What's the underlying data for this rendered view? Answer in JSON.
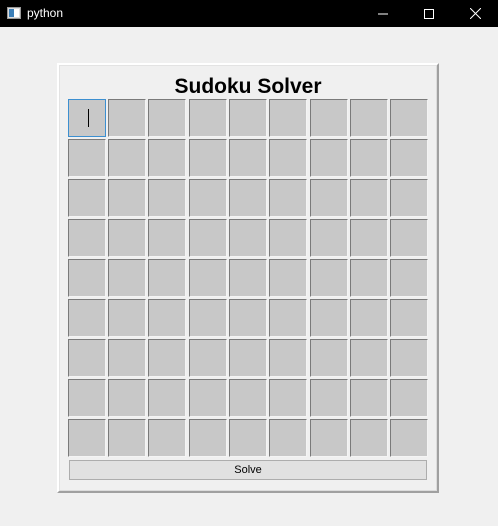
{
  "window": {
    "title": "python",
    "controls": {
      "minimize_icon": "minimize-icon",
      "maximize_icon": "maximize-icon",
      "close_icon": "close-icon"
    }
  },
  "app": {
    "heading": "Sudoku Solver",
    "solve_label": "Solve",
    "focused_cell": "r1c1",
    "board": [
      [
        "",
        "",
        "",
        "",
        "",
        "",
        "",
        "",
        ""
      ],
      [
        "",
        "",
        "",
        "",
        "",
        "",
        "",
        "",
        ""
      ],
      [
        "",
        "",
        "",
        "",
        "",
        "",
        "",
        "",
        ""
      ],
      [
        "",
        "",
        "",
        "",
        "",
        "",
        "",
        "",
        ""
      ],
      [
        "",
        "",
        "",
        "",
        "",
        "",
        "",
        "",
        ""
      ],
      [
        "",
        "",
        "",
        "",
        "",
        "",
        "",
        "",
        ""
      ],
      [
        "",
        "",
        "",
        "",
        "",
        "",
        "",
        "",
        ""
      ],
      [
        "",
        "",
        "",
        "",
        "",
        "",
        "",
        "",
        ""
      ],
      [
        "",
        "",
        "",
        "",
        "",
        "",
        "",
        "",
        ""
      ]
    ]
  },
  "colors": {
    "titlebar": "#000000",
    "background": "#f0f0f0",
    "cell": "#c8c8c8",
    "focus_border": "#3c8fd0",
    "button": "#e1e1e1"
  }
}
